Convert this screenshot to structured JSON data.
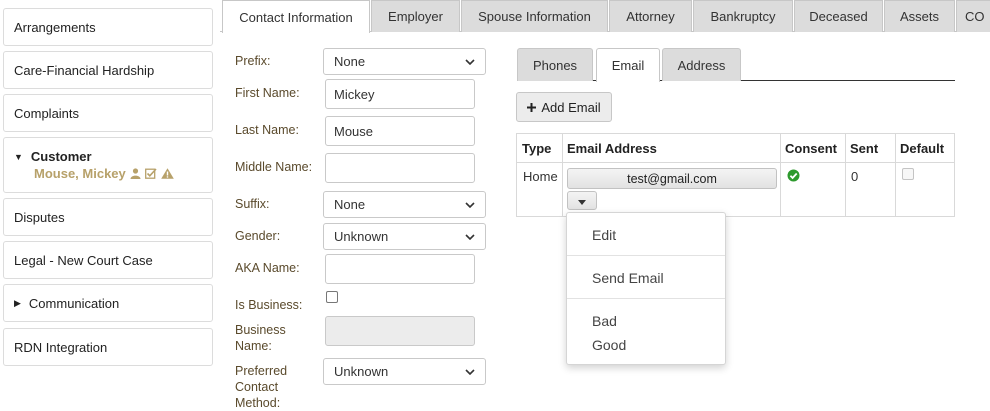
{
  "sidebar": {
    "items": [
      {
        "label": "Arrangements"
      },
      {
        "label": "Care-Financial Hardship"
      },
      {
        "label": "Complaints"
      },
      {
        "label": "Customer",
        "sub": "Mouse, Mickey"
      },
      {
        "label": "Disputes"
      },
      {
        "label": "Legal - New Court Case"
      },
      {
        "label": "Communication"
      },
      {
        "label": "RDN Integration"
      }
    ]
  },
  "top_tabs": [
    "Contact Information",
    "Employer",
    "Spouse Information",
    "Attorney",
    "Bankruptcy",
    "Deceased",
    "Assets",
    "CO"
  ],
  "form": {
    "prefix": {
      "label": "Prefix:",
      "value": "None"
    },
    "first_name": {
      "label": "First Name:",
      "value": "Mickey"
    },
    "last_name": {
      "label": "Last Name:",
      "value": "Mouse"
    },
    "middle_name": {
      "label": "Middle Name:",
      "value": ""
    },
    "suffix": {
      "label": "Suffix:",
      "value": "None"
    },
    "gender": {
      "label": "Gender:",
      "value": "Unknown"
    },
    "aka_name": {
      "label": "AKA Name:",
      "value": ""
    },
    "is_business": {
      "label": "Is Business:"
    },
    "business_name": {
      "label_line1": "Business",
      "label_line2": "Name:",
      "value": ""
    },
    "preferred_contact": {
      "label_line1": "Preferred",
      "label_line2": "Contact",
      "label_line3": "Method:",
      "value": "Unknown"
    }
  },
  "inner_tabs": [
    "Phones",
    "Email",
    "Address"
  ],
  "add_email_label": "Add Email",
  "email_table": {
    "headers": [
      "Type",
      "Email Address",
      "Consent",
      "Sent",
      "Default"
    ],
    "rows": [
      {
        "type": "Home",
        "email": "test@gmail.com",
        "sent": "0"
      }
    ]
  },
  "dropdown_menu": [
    "Edit",
    "Send Email",
    "Bad",
    "Good"
  ],
  "colors": {
    "accent_gold": "#b7a16a",
    "label_brown": "#5a4a2c",
    "consent_green": "#2e9a2e",
    "tab_gray": "#dcdcdc"
  }
}
